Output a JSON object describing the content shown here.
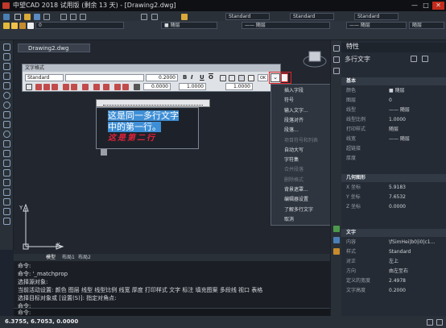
{
  "window": {
    "title": "中望CAD 2018 试用版 (剩余 13 天) - [Drawing2.dwg]",
    "minimize": "—",
    "maximize": "□",
    "close": "✕"
  },
  "toolbar": {
    "layer_name": "0",
    "style_dropdown": "Standard",
    "linetype_1": "—— 随层",
    "linetype_2": "—— 随层",
    "color_dropdown": "■ 随层",
    "color_dropdown2": "随层"
  },
  "doc_tab": {
    "label": "Drawing2.dwg"
  },
  "text_format": {
    "caption": "文字格式",
    "style_value": "Standard",
    "font_value": "",
    "height_value": "0.2000",
    "oblique_value": "0.0000",
    "tracking_value": "1.0000",
    "width_value": "1.0000",
    "ok_label": "OK",
    "bold": "B",
    "italic": "I",
    "underline": "U",
    "overline": "O",
    "options_glyph": "⌄"
  },
  "editor": {
    "line1": "这是同一多行文字",
    "line2": "中的第一行。",
    "line3": "这是第二行"
  },
  "context_menu": {
    "items": [
      {
        "label": "插入字段",
        "shortcut": "Ctrl+F",
        "disabled": false,
        "arrow": false
      },
      {
        "label": "符号",
        "shortcut": "",
        "disabled": false,
        "arrow": true
      },
      {
        "label": "输入文字...",
        "shortcut": "",
        "disabled": false,
        "arrow": false
      },
      {
        "label": "段落对齐",
        "shortcut": "",
        "disabled": false,
        "arrow": true
      },
      {
        "label": "段落...",
        "shortcut": "",
        "disabled": false,
        "arrow": false
      },
      {
        "label": "项目符号和列表",
        "shortcut": "",
        "disabled": true,
        "arrow": false
      },
      {
        "label": "自动大写",
        "shortcut": "",
        "disabled": false,
        "arrow": false
      },
      {
        "label": "字符集",
        "shortcut": "",
        "disabled": false,
        "arrow": true
      },
      {
        "label": "合并段落",
        "shortcut": "",
        "disabled": true,
        "arrow": false
      },
      {
        "label": "删除格式",
        "shortcut": "",
        "disabled": true,
        "arrow": false
      },
      {
        "label": "背景遮罩...",
        "shortcut": "",
        "disabled": false,
        "arrow": false
      },
      {
        "label": "编辑器设置",
        "shortcut": "",
        "disabled": false,
        "arrow": true
      },
      {
        "label": "了解多行文字",
        "shortcut": "",
        "disabled": false,
        "arrow": true
      },
      {
        "label": "取消",
        "shortcut": "",
        "disabled": false,
        "arrow": false
      }
    ]
  },
  "properties": {
    "header": "特性",
    "object_type": "多行文字",
    "sections": {
      "basic": "基本",
      "geometry": "几何图形",
      "text": "文字"
    },
    "basic_rows": [
      {
        "k": "颜色",
        "v": "■ 随层"
      },
      {
        "k": "图层",
        "v": "0"
      },
      {
        "k": "线型",
        "v": "—— 随层"
      },
      {
        "k": "线型比例",
        "v": "1.0000"
      },
      {
        "k": "打印样式",
        "v": "随层"
      },
      {
        "k": "线宽",
        "v": "—— 随层"
      },
      {
        "k": "超链接",
        "v": ""
      },
      {
        "k": "厚度",
        "v": ""
      }
    ],
    "geometry_rows": [
      {
        "k": "X 坐标",
        "v": "5.9183"
      },
      {
        "k": "Y 坐标",
        "v": "7.6532"
      },
      {
        "k": "Z 坐标",
        "v": "0.0000"
      }
    ],
    "text_rows": [
      {
        "k": "内容",
        "v": "\\fSimHei|b0|i0|c1..."
      },
      {
        "k": "样式",
        "v": "Standard"
      },
      {
        "k": "对正",
        "v": "左上"
      },
      {
        "k": "方向",
        "v": "由左至右"
      },
      {
        "k": "定义的宽度",
        "v": "2.4978"
      },
      {
        "k": "文字高度",
        "v": "0.2000"
      }
    ]
  },
  "model_tabs": [
    "模型",
    "布局1",
    "布局2"
  ],
  "command_lines": [
    "命令:",
    "命令: '_matchprop",
    "选择源对象:",
    "当前活动设置: 颜色 图层 线型 线型比例 线宽 厚度 打印样式 文字 标注 填充图案 多段线 视口 表格",
    "选择目标对象或 [设置(S)]: 指定对角点:",
    "命令:"
  ],
  "command_prompt": "命令:",
  "status": {
    "coords": "6.3755, 6.7053, 0.0000"
  },
  "axis": {
    "x": "X",
    "y": "Y"
  }
}
